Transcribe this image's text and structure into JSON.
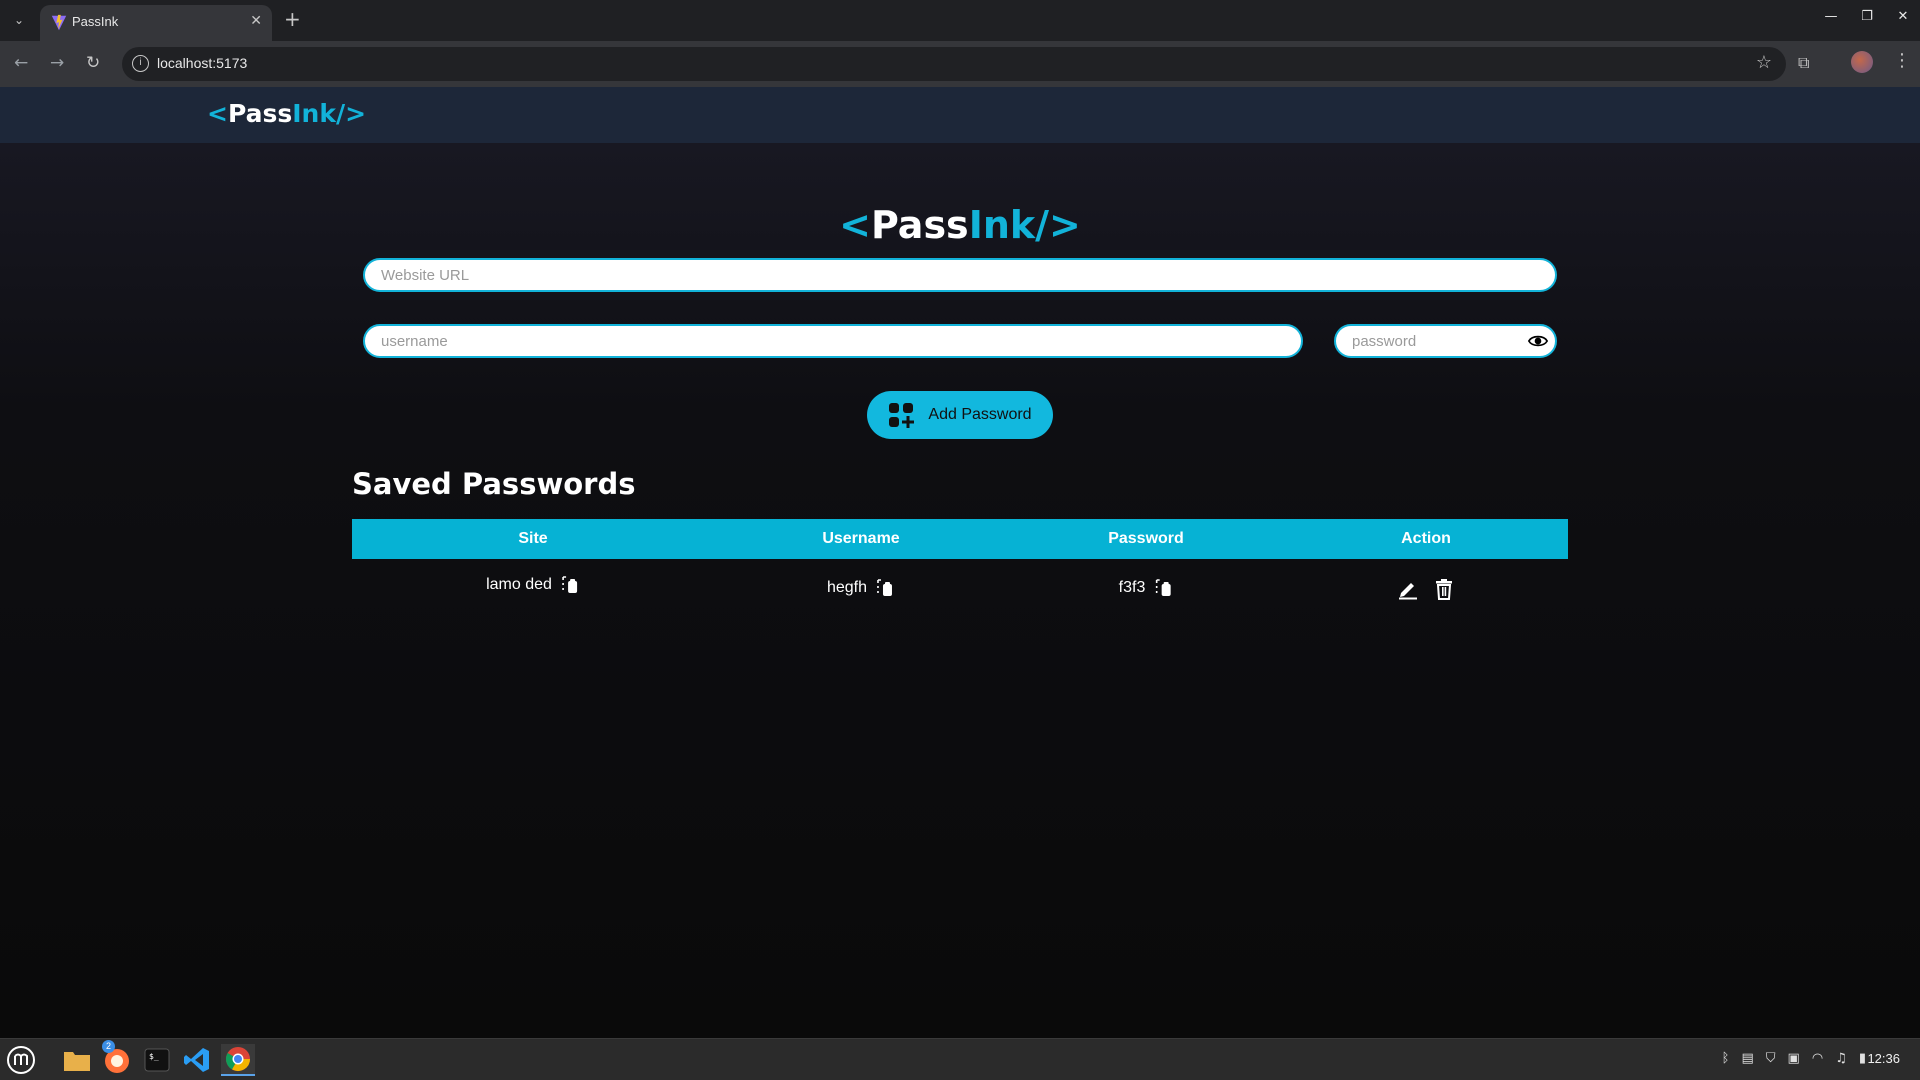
{
  "browser": {
    "tab_title": "PassInk",
    "new_tab_symbol": "+",
    "close_symbol": "✕",
    "url": "localhost:5173"
  },
  "app": {
    "logo_open": "<",
    "logo_pass": "Pass",
    "logo_ink": "Ink",
    "logo_close": "/>",
    "accent_color": "#12b3d9"
  },
  "form": {
    "url_placeholder": "Website URL",
    "username_placeholder": "username",
    "password_placeholder": "password",
    "add_button_label": "Add Password"
  },
  "saved": {
    "title": "Saved Passwords",
    "columns": [
      "Site",
      "Username",
      "Password",
      "Action"
    ],
    "rows": [
      {
        "site": "lamo ded",
        "username": "hegfh",
        "password": "f3f3"
      }
    ]
  },
  "taskbar": {
    "clock": "12:36",
    "firefox_badge": "2"
  }
}
